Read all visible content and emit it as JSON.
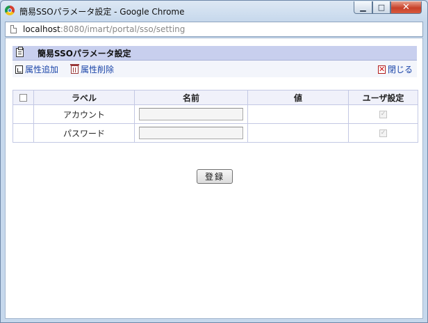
{
  "window": {
    "title": "簡易SSOパラメータ設定 - Google Chrome",
    "minimize_glyph": "▁",
    "maximize_glyph": "□",
    "close_glyph": "✕"
  },
  "address_bar": {
    "host": "localhost",
    "path": ":8080/imart/portal/sso/setting"
  },
  "panel": {
    "title": "簡易SSOパラメータ設定",
    "icon": "clipboard-icon"
  },
  "toolbar": {
    "add_label": "属性追加",
    "delete_label": "属性削除",
    "close_label": "閉じる",
    "close_glyph": "✕",
    "add_icon": "add-attribute-icon",
    "delete_icon": "trash-icon",
    "close_icon": "close-x-icon"
  },
  "table": {
    "headers": {
      "label": "ラベル",
      "name": "名前",
      "value": "値",
      "user_setting": "ユーザ設定"
    },
    "rows": [
      {
        "label": "アカウント",
        "name": "",
        "value": "",
        "user_setting": true
      },
      {
        "label": "パスワード",
        "name": "",
        "value": "",
        "user_setting": true
      }
    ],
    "check_glyph": "✓"
  },
  "register_button": {
    "label": "登録"
  },
  "colors": {
    "panel_header_bg": "#c8cfee",
    "link_text": "#1a44a8",
    "table_border": "#c3c8e4"
  }
}
